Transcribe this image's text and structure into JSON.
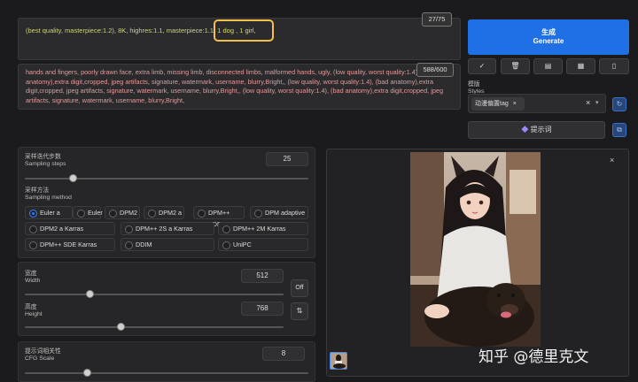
{
  "prompt": {
    "text_before": "(best quality, masterpiece:1.2), 8K, highres:1.1, masterpiece:1.1, ",
    "text_highlight": "1 dog , 1 girl,",
    "counter": "27/75"
  },
  "negative": {
    "text": "hands and fingers, poorly drawn face, extra limb, missing limb, disconnected limbs, malformed hands, ugly, (low quality, worst quality:1.4), (bad anatomy),extra digit,cropped, jpeg artifacts, signature, watermark, username, blurry,Bright,, (low quality, worst quality:1.4), (bad anatomy),extra digit,cropped, jpeg artifacts, signature, watermark, username, blurry,Bright,, (low quality, worst quality:1.4), (bad anatomy),extra digit,cropped, jpeg artifacts, signature, watermark, username, blurry,Bright,",
    "counter": "588/600"
  },
  "generate": {
    "cn": "生成",
    "en": "Generate"
  },
  "toolbar": [
    "✓",
    "🗑",
    "▤",
    "▦",
    "▯"
  ],
  "styles": {
    "label_cn": "模版",
    "label_en": "Styles",
    "tag": "动漫偏置tag",
    "tag_close": "×",
    "clear": "×",
    "dropdown": "▾",
    "hint_button": "提示词",
    "refresh": "↻",
    "apply": "⧉"
  },
  "steps": {
    "label_cn": "采样迭代步数",
    "label_en": "Sampling steps",
    "value": "25",
    "fraction": 0.17
  },
  "method": {
    "label_cn": "采样方法",
    "label_en": "Sampling method",
    "options": [
      "Euler a",
      "Euler",
      "DPM2",
      "DPM2 a",
      "DPM++ SDE",
      "DPM adaptive",
      "DPM2 a Karras",
      "DPM++ 2S a Karras",
      "DPM++ 2M Karras",
      "DPM++ SDE Karras",
      "DDIM",
      "UniPC"
    ],
    "selected": "Euler a"
  },
  "width": {
    "label_cn": "宽度",
    "label_en": "Width",
    "value": "512",
    "fraction": 0.25
  },
  "height": {
    "label_cn": "高度",
    "label_en": "Height",
    "value": "768",
    "fraction": 0.37
  },
  "off_button": "Off",
  "swap_button": "⇅",
  "cfg": {
    "label_cn": "提示词相关性",
    "label_en": "CFG Scale",
    "value": "8",
    "fraction": 0.22
  },
  "image_close": "×",
  "watermark": "知乎 @德里克文"
}
